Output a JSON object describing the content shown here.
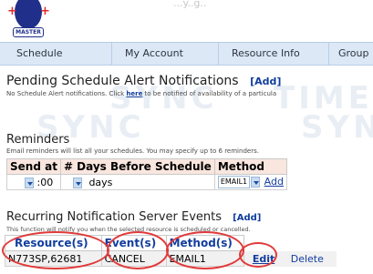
{
  "header": {
    "logo_text": "MASTER",
    "top_text": "...y..g.."
  },
  "nav": {
    "items": [
      {
        "label": "Schedule"
      },
      {
        "label": "My Account"
      },
      {
        "label": "Resource Info"
      },
      {
        "label": "Group"
      }
    ]
  },
  "watermark": {
    "line1": "SYNC",
    "line1_b": "TIME",
    "line2": "SYNC",
    "line2_b": "SYNC"
  },
  "pending": {
    "title": "Pending Schedule Alert Notifications",
    "add_label": "[Add]",
    "desc_prefix": "No Schedule Alert notifications. Click ",
    "desc_link": "here",
    "desc_suffix": " to be notified of availability of a particula"
  },
  "reminders": {
    "title": "Reminders",
    "desc": "Email reminders will list all your schedules. You may specify up to 6 reminders.",
    "headers": [
      "Send at",
      "# Days Before Schedule",
      "Method"
    ],
    "row": {
      "time_value": ":00",
      "days_value": "days",
      "method_value": "EMAIL1",
      "add_label": "Add"
    }
  },
  "recurring": {
    "title": "Recurring Notification Server Events",
    "add_label": "[Add]",
    "desc": "This function will notify you when the selected resource is scheduled or cancelled.",
    "headers": [
      "Resource(s)",
      "Event(s)",
      "Method(s)"
    ],
    "rows": [
      {
        "resource": "N773SP,62681",
        "event": "CANCEL",
        "method": "EMAIL1",
        "edit_label": "Edit",
        "delete_label": "Delete"
      }
    ]
  },
  "colors": {
    "nav_bg": "#dce8f6",
    "header_bg": "#f9e6de",
    "link": "#123d9f",
    "annotation": "#e03a3a"
  }
}
